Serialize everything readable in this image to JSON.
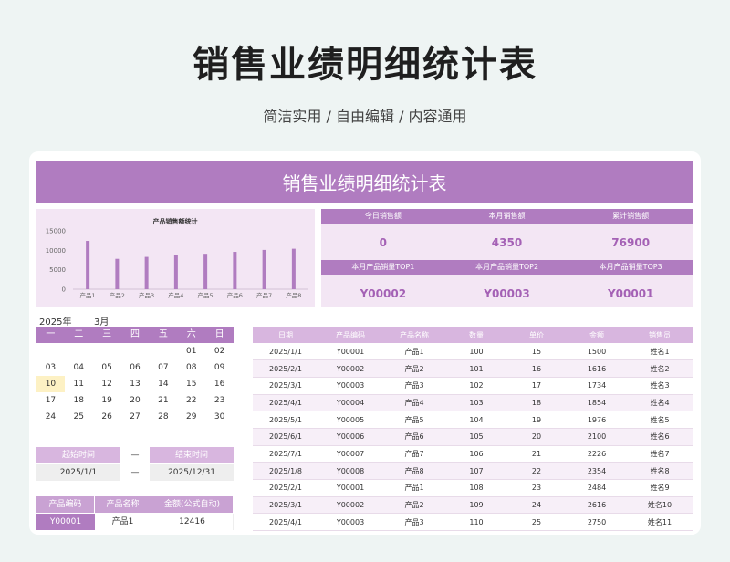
{
  "page": {
    "title": "销售业绩明细统计表",
    "subtitle": "简洁实用 / 自由编辑 / 内容通用"
  },
  "sheet": {
    "banner": "销售业绩明细统计表"
  },
  "chart_data": {
    "type": "bar",
    "title": "产品销售额统计",
    "categories": [
      "产品1",
      "产品2",
      "产品3",
      "产品4",
      "产品5",
      "产品6",
      "产品7",
      "产品8"
    ],
    "series": [
      {
        "values": [
          12416,
          7800,
          8300,
          8800,
          9100,
          9600,
          10100,
          10400
        ]
      }
    ],
    "yticks": [
      "15000",
      "10000",
      "5000",
      "0"
    ],
    "ylim": [
      0,
      15000
    ],
    "color": "#b07cc0"
  },
  "kpi": {
    "row1_labels": [
      "今日销售额",
      "本月销售额",
      "累计销售额"
    ],
    "row1_values": [
      "0",
      "4350",
      "76900"
    ],
    "row2_labels": [
      "本月产品销量TOP1",
      "本月产品销量TOP2",
      "本月产品销量TOP3"
    ],
    "row2_values": [
      "Y00002",
      "Y00003",
      "Y00001"
    ]
  },
  "calendar": {
    "year": "2025年",
    "month": "3月",
    "weekdays": [
      "一",
      "二",
      "三",
      "四",
      "五",
      "六",
      "日"
    ],
    "days": [
      "",
      "",
      "",
      "",
      "",
      "01",
      "02",
      "03",
      "04",
      "05",
      "06",
      "07",
      "08",
      "09",
      "10",
      "11",
      "12",
      "13",
      "14",
      "15",
      "16",
      "17",
      "18",
      "19",
      "20",
      "21",
      "22",
      "23",
      "24",
      "25",
      "26",
      "27",
      "28",
      "29",
      "30",
      "",
      "",
      "",
      "",
      "",
      "",
      ""
    ],
    "today": "10"
  },
  "range": {
    "start_label": "起始时间",
    "dash": "—",
    "end_label": "结束时间",
    "start_value": "2025/1/1",
    "end_value": "2025/12/31"
  },
  "product_lookup": {
    "headers": [
      "产品编码",
      "产品名称",
      "金额(公式自动)"
    ],
    "row": [
      "Y00001",
      "产品1",
      "12416"
    ]
  },
  "sales_table": {
    "headers": [
      "日期",
      "产品编码",
      "产品名称",
      "数量",
      "单价",
      "金额",
      "销售员"
    ],
    "rows": [
      [
        "2025/1/1",
        "Y00001",
        "产品1",
        "100",
        "15",
        "1500",
        "姓名1"
      ],
      [
        "2025/2/1",
        "Y00002",
        "产品2",
        "101",
        "16",
        "1616",
        "姓名2"
      ],
      [
        "2025/3/1",
        "Y00003",
        "产品3",
        "102",
        "17",
        "1734",
        "姓名3"
      ],
      [
        "2025/4/1",
        "Y00004",
        "产品4",
        "103",
        "18",
        "1854",
        "姓名4"
      ],
      [
        "2025/5/1",
        "Y00005",
        "产品5",
        "104",
        "19",
        "1976",
        "姓名5"
      ],
      [
        "2025/6/1",
        "Y00006",
        "产品6",
        "105",
        "20",
        "2100",
        "姓名6"
      ],
      [
        "2025/7/1",
        "Y00007",
        "产品7",
        "106",
        "21",
        "2226",
        "姓名7"
      ],
      [
        "2025/1/8",
        "Y00008",
        "产品8",
        "107",
        "22",
        "2354",
        "姓名8"
      ],
      [
        "2025/2/1",
        "Y00001",
        "产品1",
        "108",
        "23",
        "2484",
        "姓名9"
      ],
      [
        "2025/3/1",
        "Y00002",
        "产品2",
        "109",
        "24",
        "2616",
        "姓名10"
      ],
      [
        "2025/4/1",
        "Y00003",
        "产品3",
        "110",
        "25",
        "2750",
        "姓名11"
      ]
    ]
  }
}
